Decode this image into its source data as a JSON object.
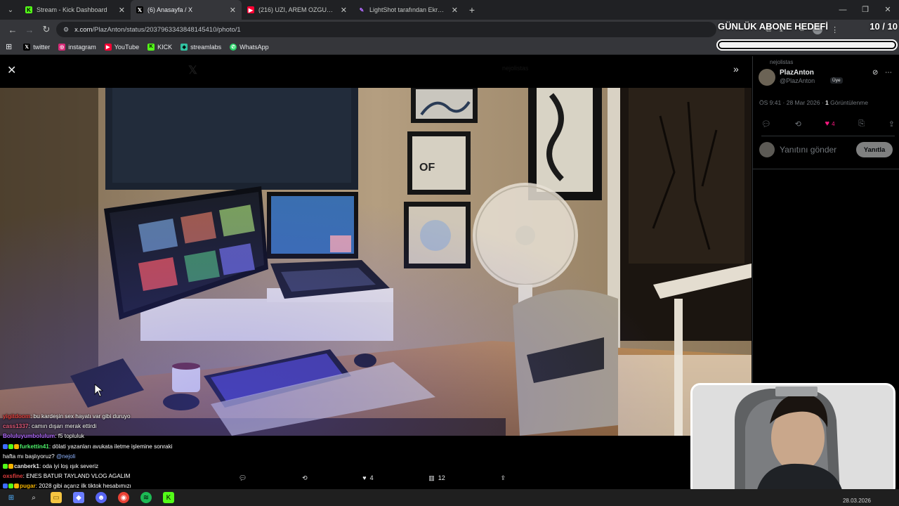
{
  "tabs": [
    {
      "label": "Stream - Kick Dashboard",
      "icon": "kick-icon",
      "active": false
    },
    {
      "label": "(6) Anasayfa / X",
      "icon": "x-icon",
      "active": true
    },
    {
      "label": "(216) UZI, AREM OZGUC, ARMA",
      "icon": "youtube-icon",
      "active": false
    },
    {
      "label": "LightShot tarafından Ekran Gör",
      "icon": "lightshot-icon",
      "active": false
    }
  ],
  "address": {
    "host": "x.com",
    "path": "/PlazAnton/status/2037963343848145410/photo/1"
  },
  "bookmarks": [
    {
      "label": "twitter",
      "icon": "x-icon"
    },
    {
      "label": "instagram",
      "icon": "instagram-icon"
    },
    {
      "label": "YouTube",
      "icon": "youtube-icon"
    },
    {
      "label": "KICK",
      "icon": "kick-icon"
    },
    {
      "label": "streamlabs",
      "icon": "streamlabs-icon"
    },
    {
      "label": "WhatsApp",
      "icon": "whatsapp-icon"
    }
  ],
  "goal": {
    "title": "GÜNLÜK ABONE HEDEFİ",
    "count": "10 / 10",
    "progress": 1.0
  },
  "tweet": {
    "social_context": "nejolistas",
    "author_name": "PlazAnton",
    "author_handle": "@PlazAnton",
    "badge": "Üye",
    "time": "ÖS 9:41 · 28 Mar 2026 · ",
    "views_count": "1",
    "views_label": " Görüntülenme",
    "reply_placeholder": "Yanıtını gönder",
    "reply_button": "Yanıtla",
    "like_count": "4",
    "views_short": "12",
    "ghost_link": "nejolistas"
  },
  "chat": [
    {
      "user": "yigitdoom",
      "color": "#e03d3d",
      "text": ": bu kardeşin sex hayatı var gibi duruyo",
      "badges": []
    },
    {
      "user": "cass1337",
      "color": "#e05a7a",
      "text": ": camın dışarı merak ettirdi",
      "badges": []
    },
    {
      "user": "Boluluyumbolulum",
      "color": "#b36bff",
      "text": ": f5 topluluk",
      "badges": []
    },
    {
      "user": "furkettin41",
      "color": "#4ef06a",
      "text": ": dölati yazanları avukata iletme işlemine sonraki",
      "badges": [
        "#3b6cff",
        "#53fc18",
        "#f5b400"
      ]
    },
    {
      "user": "",
      "color": "#ffffff",
      "text": "hafta mı başlıyoruz? ",
      "mention": "@nejoli",
      "badges": []
    },
    {
      "user": "canberk1",
      "color": "#e8e8e8",
      "text": ": oda iyi loş ışık severiz",
      "badges": [
        "#53fc18",
        "#f5b400"
      ]
    },
    {
      "user": "oxsfine",
      "color": "#e03d3d",
      "text": ": ENES BATUR TAYLAND VLOG AGALIM",
      "badges": []
    },
    {
      "user": "pugar",
      "color": "#f5b400",
      "text": ": 2028 gibi açarız ilk tiktok hesabımızı",
      "badges": [
        "#3b6cff",
        "#53fc18",
        "#f5b400"
      ]
    }
  ],
  "taskbar": {
    "date": "28.03.2026",
    "apps": [
      "windows-start-icon",
      "search-icon",
      "file-explorer-icon",
      "app-icon",
      "discord-icon",
      "chrome-icon",
      "spotify-icon",
      "kick-app-icon"
    ]
  },
  "colors": {
    "x_like": "#f91880",
    "kick_green": "#53fc18",
    "youtube_red": "#ff0033"
  }
}
